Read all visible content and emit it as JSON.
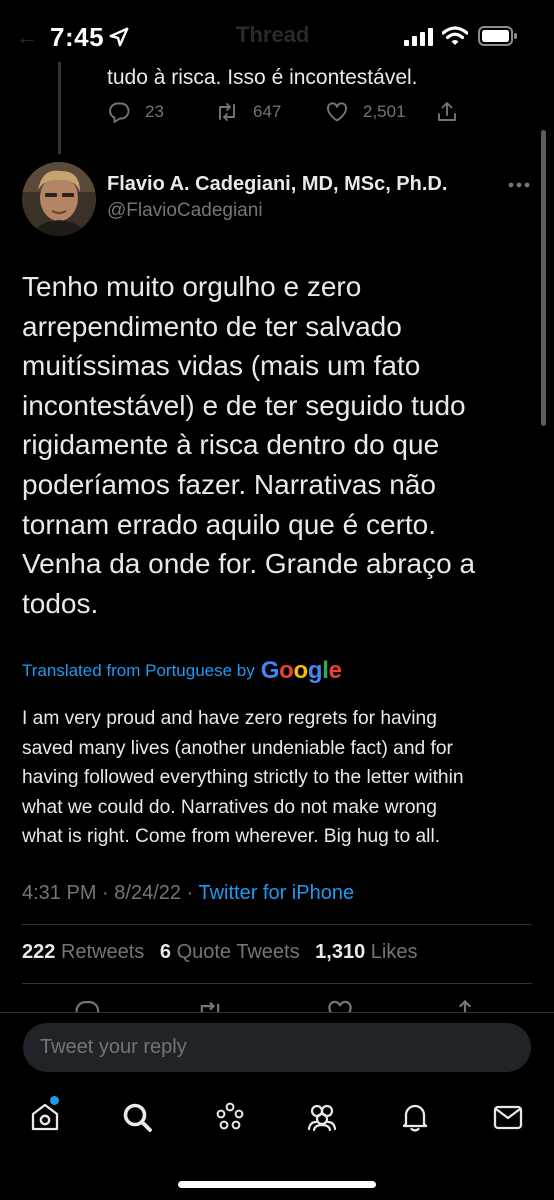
{
  "status_bar": {
    "time": "7:45",
    "back_glyph": "←",
    "header_title_ghost": "Thread"
  },
  "previous_tweet": {
    "text_tail": "tudo à risca. Isso é incontestável.",
    "reply_count": "23",
    "retweet_count": "647",
    "like_count": "2,501"
  },
  "tweet": {
    "author": {
      "display_name": "Flavio A. Cadegiani, MD, MSc, Ph.D.",
      "handle": "@FlavioCadegiani"
    },
    "body_lines": [
      "Tenho muito orgulho e zero",
      "arrependimento de ter salvado",
      "muitíssimas vidas (mais um fato",
      "incontestável) e de ter seguido tudo",
      "rigidamente à risca dentro do que",
      "poderíamos fazer. Narrativas não",
      "tornam errado aquilo que é certo.",
      "Venha da onde for. Grande abraço a",
      "todos."
    ],
    "translated_label": "Translated from Portuguese by",
    "google_letters": [
      "G",
      "o",
      "o",
      "g",
      "l",
      "e"
    ],
    "translation_lines": [
      "I am very proud and have zero regrets for having",
      "saved many lives (another undeniable fact) and for",
      "having followed everything strictly to the letter within",
      "what we could do. Narratives do not make wrong",
      "what is right. Come from wherever. Big hug to all."
    ],
    "time": "4:31 PM",
    "date": "8/24/22",
    "separator": "·",
    "source": "Twitter for iPhone",
    "stats": {
      "retweets_count": "222",
      "retweets_label": "Retweets",
      "quotes_count": "6",
      "quotes_label": "Quote Tweets",
      "likes_count": "1,310",
      "likes_label": "Likes"
    }
  },
  "reply_bar": {
    "placeholder": "Tweet your reply"
  },
  "tab_bar": {
    "items": [
      "home-icon",
      "search-icon",
      "spaces-icon",
      "communities-icon",
      "notifications-icon",
      "messages-icon"
    ]
  },
  "colors": {
    "background": "#000000",
    "text_primary": "#e7e9ea",
    "text_secondary": "#71767b",
    "accent": "#1d9bf0"
  }
}
